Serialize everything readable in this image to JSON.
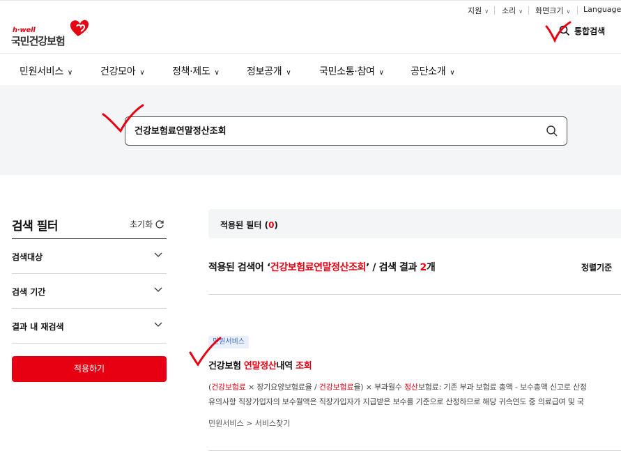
{
  "utility": {
    "support": "지원",
    "sound": "소리",
    "zoom": "화면크기",
    "language": "Language"
  },
  "logo": {
    "tagline": "h·well",
    "name": "국민건강보험"
  },
  "header": {
    "unified_search": "통합검색"
  },
  "gnb": [
    {
      "label": "민원서비스"
    },
    {
      "label": "건강모아"
    },
    {
      "label": "정책·제도"
    },
    {
      "label": "정보공개"
    },
    {
      "label": "국민소통·참여"
    },
    {
      "label": "공단소개"
    }
  ],
  "search": {
    "value": "건강보험료연말정산조회"
  },
  "filter": {
    "title": "검색 필터",
    "reset": "초기화",
    "rows": [
      {
        "label": "검색대상"
      },
      {
        "label": "검색 기간"
      },
      {
        "label": "결과 내 재검색"
      }
    ],
    "apply": "적용하기"
  },
  "applied_filter": {
    "label": "적용된 필터",
    "count": "0"
  },
  "summary": {
    "prefix": "적용된 검색어 ‘",
    "keyword": "건강보험료연말정산조회",
    "middle": "’ / 검색 결과 ",
    "count": "2",
    "suffix": "개",
    "sort_label": "정렬기준"
  },
  "result": {
    "badge": "민원서비스",
    "title_parts": [
      "건강보험 ",
      "연말정산",
      "내역 ",
      "조회"
    ],
    "desc1_parts": [
      "(",
      "건강보험료",
      " × 장기요양보험료율 / ",
      "건강보험료",
      "율) × 부과월수 ",
      "정산",
      "보험료: 기존 부과 보험료 총액 - 보수총액 신고로 산정"
    ],
    "desc2": "유의사항 직장가입자의 보수월액은 직장가입자가 지급받은 보수를 기준으로 산정하므로 해당 귀속연도 중 의료급여 및 국",
    "path": "민원서비스 > 서비스찾기"
  },
  "colors": {
    "brand": "#e60012",
    "badge_bg": "#e9f0fb",
    "badge_text": "#3b66c4",
    "hero_bg": "#f4f5f7"
  }
}
